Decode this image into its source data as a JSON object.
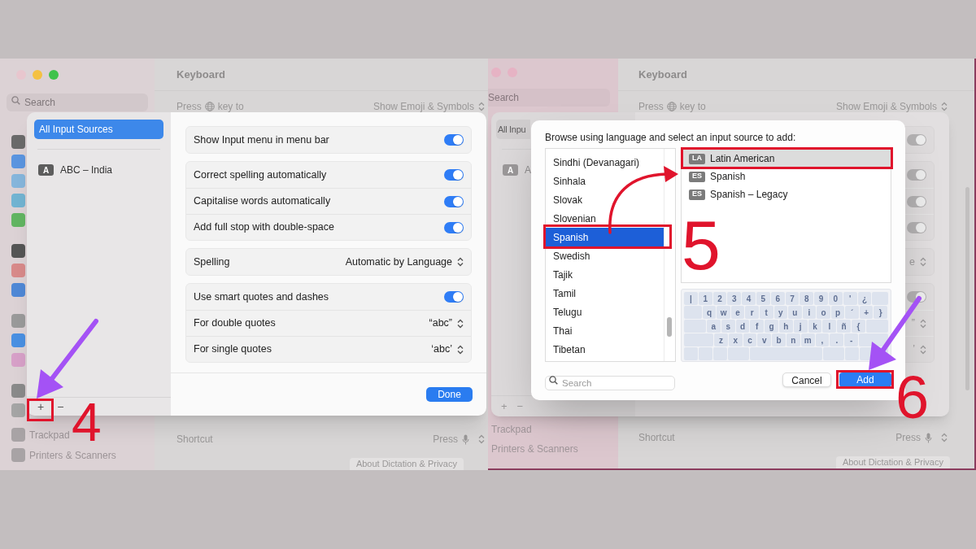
{
  "left_screenshot": {
    "sidebar": {
      "search_placeholder": "Search",
      "items": [
        {
          "label": "Trackpad"
        },
        {
          "label": "Printers & Scanners"
        }
      ]
    },
    "main": {
      "title": "Keyboard",
      "key_row": {
        "before": "Press",
        "after": "key to",
        "value": "Show Emoji & Symbols"
      },
      "shortcut_row": {
        "label": "Shortcut",
        "value": "Press"
      },
      "privacy_button": "About Dictation & Privacy"
    },
    "sheet": {
      "all_sources": {
        "label": "All Input Sources",
        "selected": true
      },
      "sources": [
        {
          "badge": "A",
          "label": "ABC – India",
          "selected": false
        }
      ],
      "add_button": "+",
      "remove_button": "−",
      "groups": [
        [
          {
            "kind": "toggle",
            "label": "Show Input menu in menu bar",
            "on": true
          }
        ],
        [
          {
            "kind": "toggle",
            "label": "Correct spelling automatically",
            "on": true
          },
          {
            "kind": "toggle",
            "label": "Capitalise words automatically",
            "on": true
          },
          {
            "kind": "toggle",
            "label": "Add full stop with double-space",
            "on": true
          }
        ],
        [
          {
            "kind": "popup",
            "label": "Spelling",
            "value": "Automatic by Language"
          }
        ],
        [
          {
            "kind": "toggle",
            "label": "Use smart quotes and dashes",
            "on": true
          },
          {
            "kind": "popup",
            "label": "For double quotes",
            "value": "“abc”"
          },
          {
            "kind": "popup",
            "label": "For single quotes",
            "value": "‘abc’"
          }
        ]
      ],
      "done_button": "Done"
    },
    "step": "4"
  },
  "right_screenshot": {
    "sidebar": {
      "search_placeholder": "Search",
      "items": [
        {
          "label": "Trackpad"
        },
        {
          "label": "Printers & Scanners"
        }
      ]
    },
    "main": {
      "title": "Keyboard",
      "key_row": {
        "before": "Press",
        "after": "key to",
        "value": "Show Emoji & Symbols"
      },
      "shortcut_row": {
        "label": "Shortcut",
        "value": "Press"
      },
      "privacy_button": "About Dictation & Privacy"
    },
    "background_sheet": {
      "all_sources_label": "All Inpu",
      "source_badge": "A",
      "source_label": "A",
      "add_button": "+",
      "remove_button": "−",
      "groups": [
        [
          {
            "kind": "toggle",
            "on": true
          }
        ],
        [
          {
            "kind": "toggle",
            "on": true
          },
          {
            "kind": "toggle",
            "on": true
          },
          {
            "kind": "toggle",
            "on": true
          }
        ],
        [
          {
            "kind": "popup",
            "value": "e"
          }
        ],
        [
          {
            "kind": "toggle",
            "on": true
          },
          {
            "kind": "popup",
            "value": "”"
          },
          {
            "kind": "popup",
            "value": "’"
          }
        ]
      ]
    },
    "dialog": {
      "title": "Browse using language and select an input source to add:",
      "languages": [
        {
          "label": "Sindhi (Devanagari)",
          "selected": false
        },
        {
          "label": "Sinhala",
          "selected": false
        },
        {
          "label": "Slovak",
          "selected": false
        },
        {
          "label": "Slovenian",
          "selected": false
        },
        {
          "label": "Spanish",
          "selected": true
        },
        {
          "label": "Swedish",
          "selected": false
        },
        {
          "label": "Tajik",
          "selected": false
        },
        {
          "label": "Tamil",
          "selected": false
        },
        {
          "label": "Telugu",
          "selected": false
        },
        {
          "label": "Thai",
          "selected": false
        },
        {
          "label": "Tibetan",
          "selected": false
        }
      ],
      "input_sources": [
        {
          "badge": "LA",
          "label": "Latin American",
          "selected": true
        },
        {
          "badge": "ES",
          "label": "Spanish",
          "selected": false
        },
        {
          "badge": "ES",
          "label": "Spanish – Legacy",
          "selected": false
        }
      ],
      "keyboard_rows": [
        [
          "|",
          "1",
          "2",
          "3",
          "4",
          "5",
          "6",
          "7",
          "8",
          "9",
          "0",
          "'",
          "¿"
        ],
        [
          "q",
          "w",
          "e",
          "r",
          "t",
          "y",
          "u",
          "i",
          "o",
          "p",
          "´",
          "+",
          "}"
        ],
        [
          "a",
          "s",
          "d",
          "f",
          "g",
          "h",
          "j",
          "k",
          "l",
          "ñ",
          "{"
        ],
        [
          "z",
          "x",
          "c",
          "v",
          "b",
          "n",
          "m",
          ",",
          ".",
          "-"
        ]
      ],
      "search_placeholder": "Search",
      "cancel_button": "Cancel",
      "add_button": "Add"
    },
    "step_first": "5",
    "step_second": "6"
  }
}
